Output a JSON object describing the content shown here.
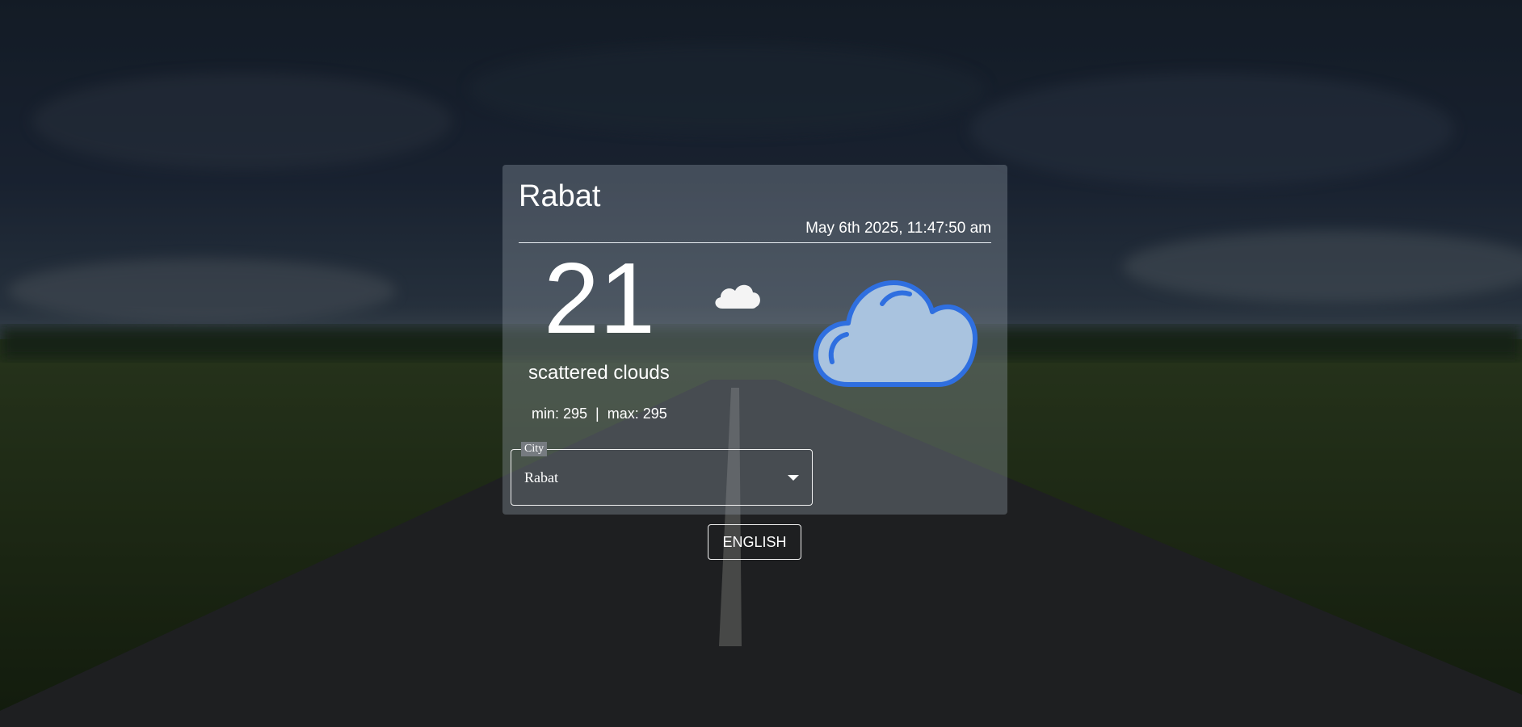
{
  "weather": {
    "city": "Rabat",
    "datetime": "May 6th 2025, 11:47:50 am",
    "temperature": "21",
    "description": "scattered clouds",
    "minmax": "min: 295  |  max: 295",
    "small_icon": "cloud-icon",
    "large_icon": "cloud-icon"
  },
  "city_select": {
    "label": "City",
    "selected": "Rabat"
  },
  "language_button": {
    "label": "ENGLISH"
  },
  "colors": {
    "card_background": "#8c96a0",
    "text": "#ffffff",
    "cloud_fill": "#a9c3df",
    "cloud_outline": "#2f6fe0"
  }
}
